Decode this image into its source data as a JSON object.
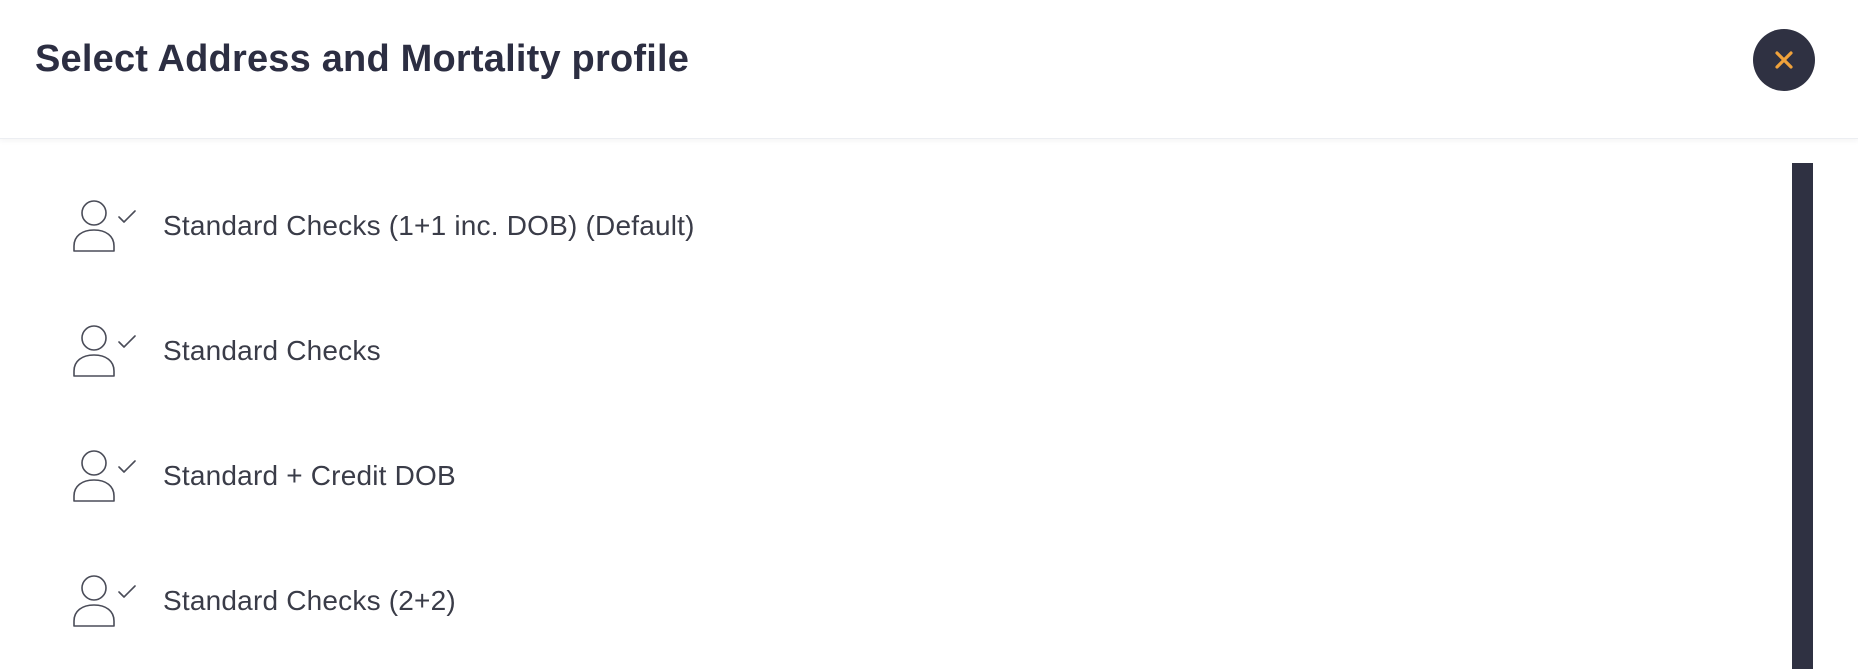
{
  "modal": {
    "title": "Select Address and Mortality profile",
    "close_icon": "close-icon",
    "close_icon_color": "#f0a23b",
    "close_button_bg": "#2f3142"
  },
  "profiles": [
    {
      "label": "Standard Checks (1+1 inc. DOB) (Default)",
      "icon": "user-check-icon"
    },
    {
      "label": "Standard Checks",
      "icon": "user-check-icon"
    },
    {
      "label": "Standard + Credit DOB",
      "icon": "user-check-icon"
    },
    {
      "label": "Standard Checks (2+2)",
      "icon": "user-check-icon"
    }
  ],
  "colors": {
    "title_text": "#2c2e42",
    "body_text": "#3a3c48",
    "scrollbar": "#2f3142"
  }
}
